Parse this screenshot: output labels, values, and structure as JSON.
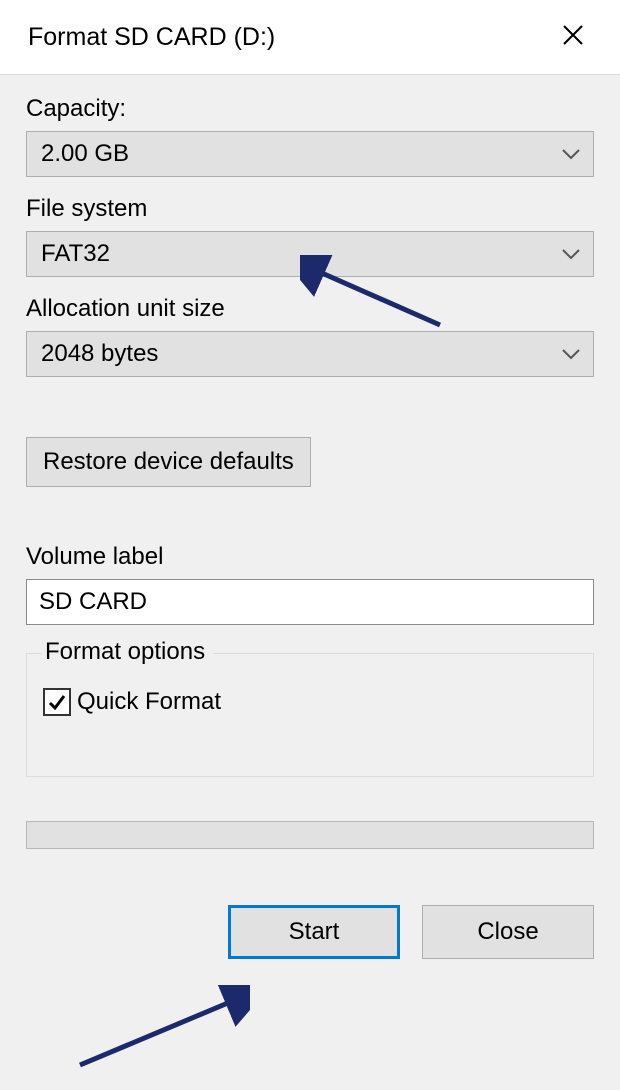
{
  "window": {
    "title": "Format SD CARD (D:)"
  },
  "fields": {
    "capacity_label": "Capacity:",
    "capacity_value": "2.00 GB",
    "filesystem_label": "File system",
    "filesystem_value": "FAT32",
    "allocation_label": "Allocation unit size",
    "allocation_value": "2048 bytes",
    "restore_defaults_label": "Restore device defaults",
    "volume_label_label": "Volume label",
    "volume_label_value": "SD CARD"
  },
  "format_options": {
    "legend": "Format options",
    "quick_format_label": "Quick Format",
    "quick_format_checked": true
  },
  "buttons": {
    "start": "Start",
    "close": "Close"
  },
  "annotations": {
    "arrow_color": "#1c2a6b"
  }
}
